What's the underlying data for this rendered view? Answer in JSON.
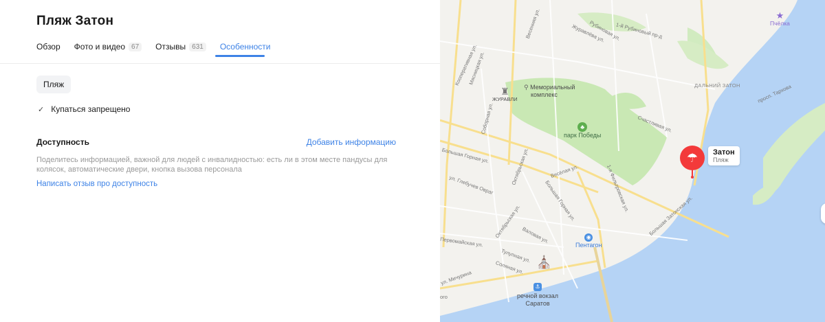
{
  "place": {
    "title": "Пляж Затон"
  },
  "tabs": [
    {
      "label": "Обзор",
      "count": ""
    },
    {
      "label": "Фото и видео",
      "count": "67"
    },
    {
      "label": "Отзывы",
      "count": "631"
    },
    {
      "label": "Особенности",
      "count": ""
    }
  ],
  "active_tab": "Особенности",
  "category_chip": "Пляж",
  "features": [
    {
      "label": "Купаться запрещено"
    }
  ],
  "accessibility": {
    "title": "Доступность",
    "add_link": "Добавить информацию",
    "description": "Поделитесь информацией, важной для людей с инвалидностью: есть ли в этом месте пандусы для колясок, автоматические двери, кнопка вызова персонала",
    "review_link": "Написать отзыв про доступность"
  },
  "map": {
    "colors": {
      "water": "#b5d3f5",
      "park": "#c9e8b4",
      "land": "#f3f2ee",
      "road": "#fbe7a4",
      "accent": "#f33a3a"
    },
    "selected_place": {
      "name": "Затон",
      "type": "Пляж"
    },
    "pois": {
      "memorial": "Мемориальный комплекс",
      "memorial_line1": "Мемориальный",
      "memorial_line2": "комплекс",
      "zhuravli": "ЖУРАВЛИ",
      "park": "парк Победы",
      "mall": "Пентагон",
      "station_line1": "речной вокзал",
      "station_line2": "Саратов",
      "pchelka": "Пчёлка"
    },
    "district": "ДАЛЬНИЙ ЗАТОН",
    "streets": {
      "zhuravlyov": "Журавлёва ул.",
      "rubinovaya": "Рубиновая ул.",
      "rubinovy1": "1-й Рубиновый пр-д",
      "vesyolaya": "Весёлая ул.",
      "sobornaya": "Соборная ул.",
      "bolshaya_gornaya": "Большая Горная ул.",
      "bolshaya_gornaya2": "Большая Горная ул.",
      "oktyabrskaya": "Октябрьская ул.",
      "oktyabrskaya2": "Октябрьская ул.",
      "glebuchev": "ул. Глебучев Овраг",
      "pervomayskaya": "Первомайская ул.",
      "tulupnaya": "Тулупная ул.",
      "solyanaya": "Соляная ул.",
      "valovaya": "Валовая ул.",
      "michurina": "ул. Мичурина",
      "bolshaya_zatonskaya": "Большая Затонская ул.",
      "schastlivaya": "Счастливая ул.",
      "fiftonovskaya": "1-я Фильтровская ул.",
      "kooperativnaya": "Кооперативная ул.",
      "myasnitskaya": "Мясницкая ул.",
      "vesennyaya": "Весенняя ул.",
      "vesennyaya_n": "Весёлая ул.",
      "tarkhova": "просп. Тархова",
      "cut_go": "ого"
    }
  }
}
